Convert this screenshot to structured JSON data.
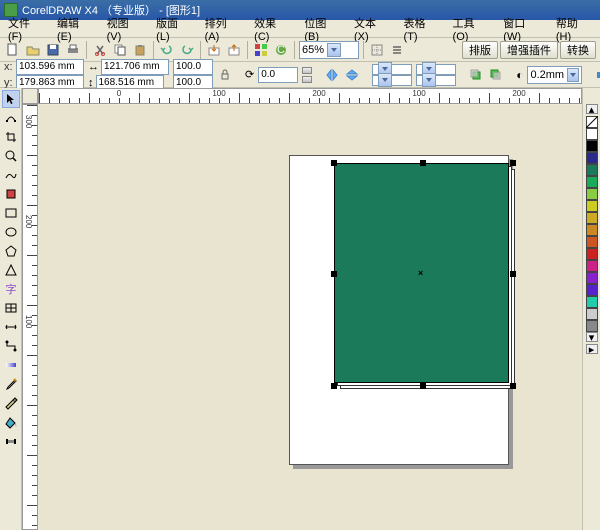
{
  "title": "CorelDRAW X4 （专业版） - [图形1]",
  "menu": [
    "文件(F)",
    "编辑(E)",
    "视图(V)",
    "版面(L)",
    "排列(A)",
    "效果(C)",
    "位图(B)",
    "文本(X)",
    "表格(T)",
    "工具(O)",
    "窗口(W)",
    "帮助(H)"
  ],
  "toolbar": {
    "zoom": "65%",
    "right_buttons": [
      "排版",
      "增强插件",
      "转换"
    ]
  },
  "propbar": {
    "x_label": "x:",
    "y_label": "y:",
    "x": "103.596 mm",
    "y": "179.863 mm",
    "w": "121.706 mm",
    "h": "168.516 mm",
    "sx": "100.0",
    "sy": "100.0",
    "rot": "0.0",
    "outline": "0.2mm"
  },
  "ruler": {
    "h_labels": [
      {
        "p": 80,
        "t": "0"
      },
      {
        "p": 180,
        "t": "100"
      },
      {
        "p": 280,
        "t": "200"
      },
      {
        "p": 380,
        "t": "100"
      },
      {
        "p": 480,
        "t": "200"
      }
    ],
    "v_labels": [
      {
        "p": 10,
        "t": "300"
      },
      {
        "p": 110,
        "t": "200"
      },
      {
        "p": 210,
        "t": "100"
      }
    ]
  },
  "colors": [
    "#ffffff",
    "#000000",
    "#2a2a8a",
    "#1a7a5a",
    "#1aaa5a",
    "#88cc44",
    "#cccc22",
    "#ccaa22",
    "#cc8822",
    "#cc5522",
    "#cc2222",
    "#cc2288",
    "#8822cc",
    "#5522cc",
    "#22ccaa",
    "#cccccc",
    "#888888"
  ],
  "shape": {
    "fill": "#1a7a5a"
  }
}
